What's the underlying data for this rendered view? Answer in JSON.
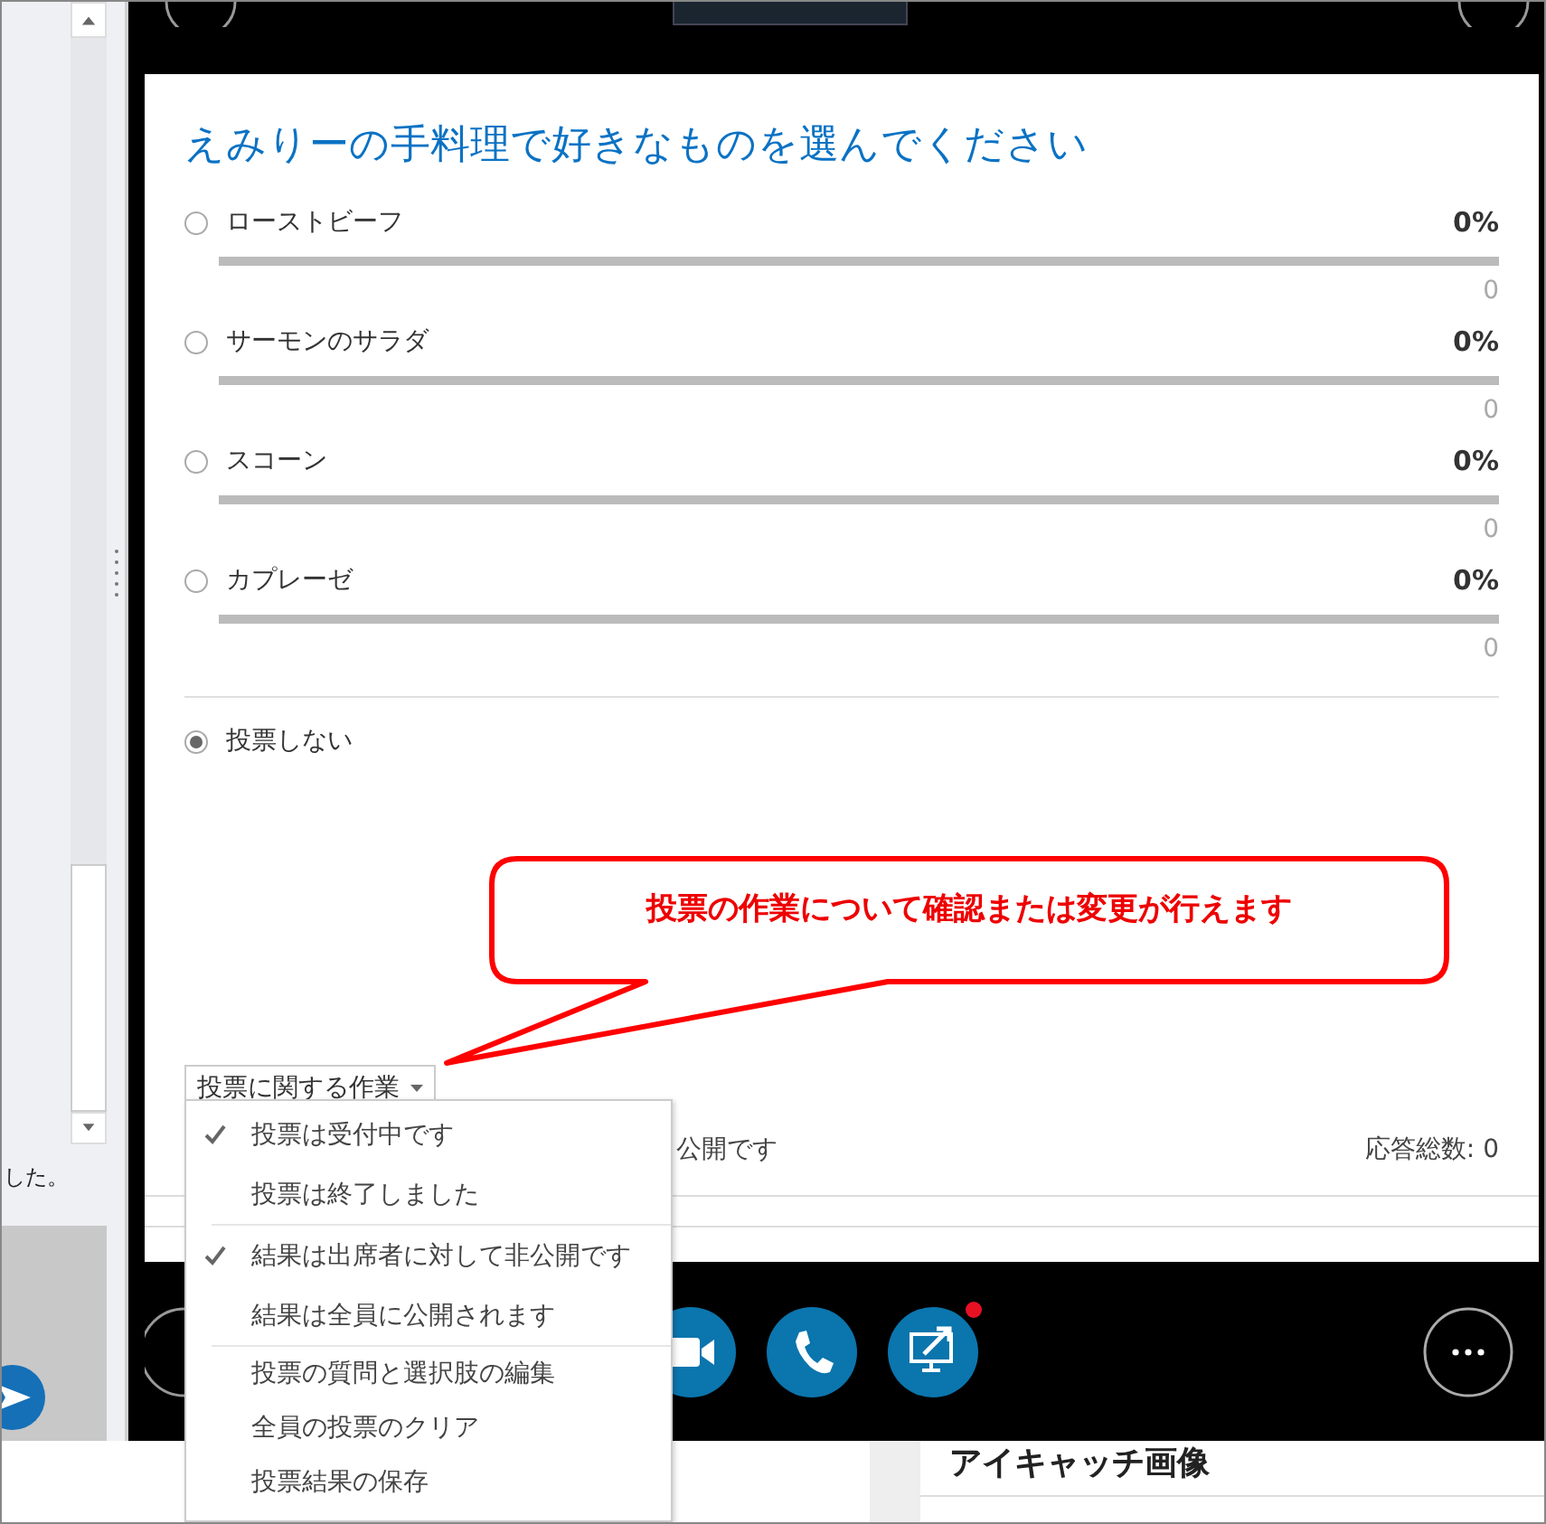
{
  "side_panel": {
    "message_fragment": "した。"
  },
  "poll": {
    "question": "えみりーの手料理で好きなものを選んでください",
    "options": [
      {
        "label": "ローストビーフ",
        "selected": false,
        "percent": "0%",
        "level": 0,
        "count": "0"
      },
      {
        "label": "サーモンのサラダ",
        "selected": false,
        "percent": "0%",
        "level": 0,
        "count": "0"
      },
      {
        "label": "スコーン",
        "selected": false,
        "percent": "0%",
        "level": 0,
        "count": "0"
      },
      {
        "label": "カプレーゼ",
        "selected": false,
        "percent": "0%",
        "level": 0,
        "count": "0"
      }
    ],
    "abstain": {
      "label": "投票しない",
      "selected": true
    },
    "actions_button": {
      "label": "投票に関する作業"
    },
    "status_text": "公開です",
    "total_responses": "応答総数: 0"
  },
  "actions_menu": {
    "groups": [
      {
        "items": [
          {
            "label": "投票は受付中です",
            "checked": true
          },
          {
            "label": "投票は終了しました",
            "checked": false
          }
        ]
      },
      {
        "items": [
          {
            "label": "結果は出席者に対して非公開です",
            "checked": true
          },
          {
            "label": "結果は全員に公開されます",
            "checked": false
          }
        ]
      },
      {
        "items": [
          {
            "label": "投票の質問と選択肢の編集",
            "checked": false
          },
          {
            "label": "全員の投票のクリア",
            "checked": false
          },
          {
            "label": "投票結果の保存",
            "checked": false
          }
        ]
      }
    ]
  },
  "call_controls": {
    "share_notification": true
  },
  "callout": {
    "text": "投票の作業について確認または変更が行えます"
  },
  "background_page": {
    "heading": "アイキャッチ画像"
  }
}
